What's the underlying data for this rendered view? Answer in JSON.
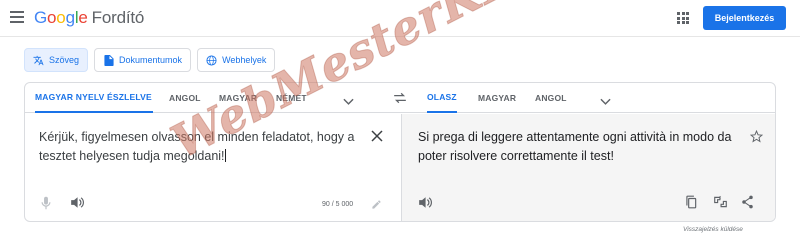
{
  "header": {
    "logo_letters": [
      "G",
      "o",
      "o",
      "g",
      "l",
      "e"
    ],
    "product": "Fordító",
    "signin_label": "Bejelentkezés"
  },
  "modes": {
    "text": "Szöveg",
    "documents": "Dokumentumok",
    "websites": "Webhelyek"
  },
  "source_langs": [
    "MAGYAR NYELV ÉSZLELVE",
    "ANGOL",
    "MAGYAR",
    "NÉMET"
  ],
  "target_langs": [
    "OLASZ",
    "MAGYAR",
    "ANGOL"
  ],
  "source": {
    "text": "Kérjük, figyelmesen olvasson el minden feladatot, hogy a tesztet helyesen tudja megoldani!",
    "char_count": "90 / 5 000"
  },
  "target": {
    "text": "Si prega di leggere attentamente ogni attività in modo da poter risolvere correttamente il test!"
  },
  "feedback_label": "Visszajelzés küldése",
  "watermark_text": "WebMesterKE",
  "colors": {
    "accent": "#1a73e8",
    "icon": "#5f6368",
    "watermark": "#cd7864"
  },
  "icons": [
    "menu-icon",
    "apps-icon",
    "translate-icon",
    "document-icon",
    "globe-icon",
    "chevron-down-icon",
    "swap-icon",
    "close-icon",
    "star-icon",
    "mic-icon",
    "speaker-icon",
    "pencil-icon",
    "copy-icon",
    "feedback-icon",
    "share-icon"
  ]
}
